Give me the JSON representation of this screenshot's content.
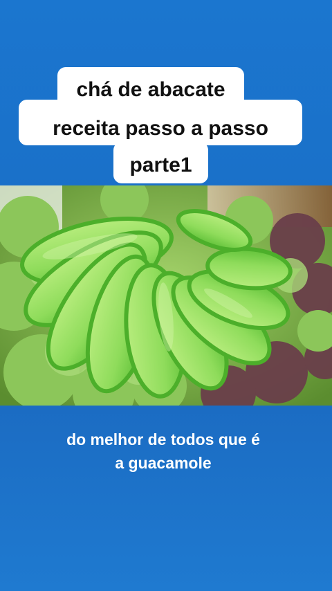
{
  "title": {
    "line1": "chá de abacate",
    "line2": "receita passo a passo",
    "line3": "parte1"
  },
  "caption": {
    "line1": "do melhor de todos que é",
    "line2": "a guacamole"
  },
  "image": {
    "subject": "avocado-slices-on-lettuce"
  },
  "colors": {
    "background": "#1a6fc7",
    "avocado_flesh": "#7ed957",
    "avocado_skin": "#4caf2a",
    "lettuce": "#8cc65a",
    "purple_lettuce": "#6a3f4a"
  }
}
